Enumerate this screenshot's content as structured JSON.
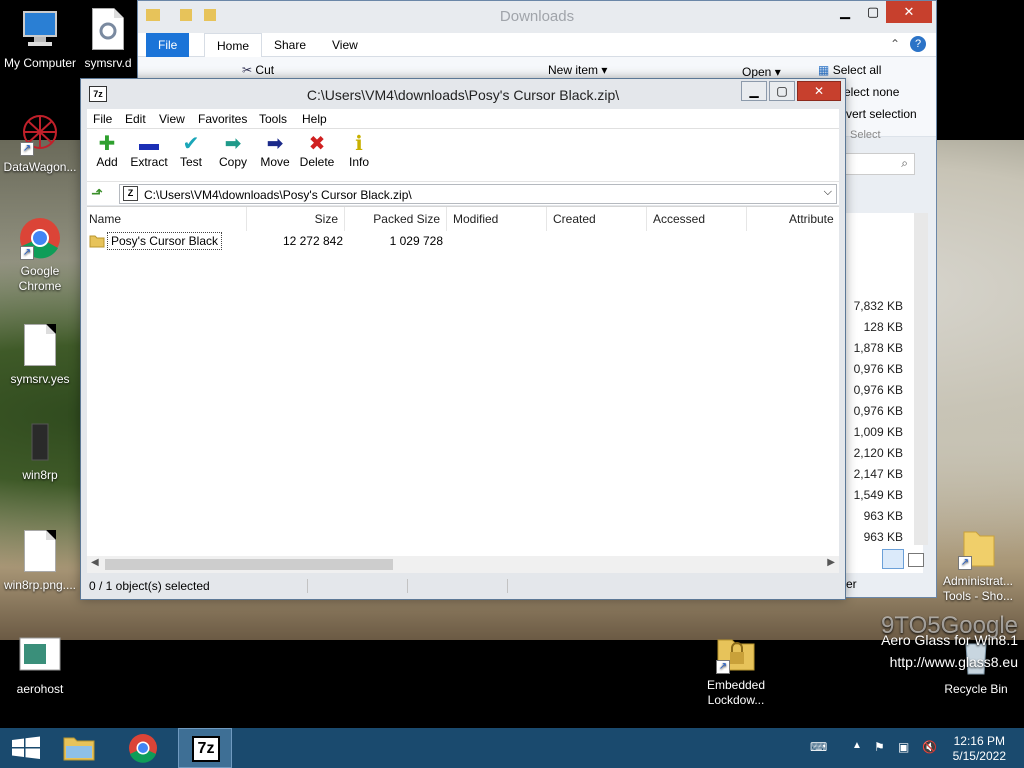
{
  "desktop": {
    "icons": [
      {
        "id": "my-computer",
        "label": "My Computer"
      },
      {
        "id": "symsrv-dll",
        "label": "symsrv.d"
      },
      {
        "id": "datawagon",
        "label": "DataWagon..."
      },
      {
        "id": "chrome",
        "label": "Google Chrome"
      },
      {
        "id": "symsrv-yes",
        "label": "symsrv.yes"
      },
      {
        "id": "win8rp",
        "label": "win8rp"
      },
      {
        "id": "win8rp-png",
        "label": "win8rp.png...."
      },
      {
        "id": "aerohost",
        "label": "aerohost"
      },
      {
        "id": "embedded",
        "label": "Embedded Lockdow..."
      },
      {
        "id": "admin-tools",
        "label": "Administrat... Tools - Sho..."
      },
      {
        "id": "recycle",
        "label": "Recycle Bin"
      }
    ],
    "watermark": "9TO5Google",
    "brand_line1": "Aero Glass for Win8.1",
    "brand_line2": "http://www.glass8.eu"
  },
  "explorer": {
    "title": "Downloads",
    "tabs": {
      "file": "File",
      "home": "Home",
      "share": "Share",
      "view": "View"
    },
    "ribbon": {
      "cut": "Cut",
      "new_item": "New item",
      "open": "Open",
      "select_all": "Select all",
      "select_none": "Select none",
      "invert": "Invert selection",
      "select_group": "Select"
    },
    "sizes": [
      "7,832 KB",
      "128 KB",
      "1,878 KB",
      "0,976 KB",
      "0,976 KB",
      "0,976 KB",
      "1,009 KB",
      "2,120 KB",
      "2,147 KB",
      "1,549 KB",
      "963 KB",
      "963 KB"
    ],
    "footer_partial": "er"
  },
  "sevenzip": {
    "title": "C:\\Users\\VM4\\downloads\\Posy's Cursor Black.zip\\",
    "menu": [
      "File",
      "Edit",
      "View",
      "Favorites",
      "Tools",
      "Help"
    ],
    "toolbar": [
      {
        "label": "Add",
        "glyph": "✚",
        "color": "#2ea02e"
      },
      {
        "label": "Extract",
        "glyph": "▬",
        "color": "#1b2fb5"
      },
      {
        "label": "Test",
        "glyph": "✔",
        "color": "#1aa6b8"
      },
      {
        "label": "Copy",
        "glyph": "➡",
        "color": "#1f9a8a"
      },
      {
        "label": "Move",
        "glyph": "➡",
        "color": "#1b2a8a"
      },
      {
        "label": "Delete",
        "glyph": "✖",
        "color": "#d02020"
      },
      {
        "label": "Info",
        "glyph": "ℹ",
        "color": "#c8b000"
      }
    ],
    "address": "C:\\Users\\VM4\\downloads\\Posy's Cursor Black.zip\\",
    "columns": [
      "Name",
      "Size",
      "Packed Size",
      "Modified",
      "Created",
      "Accessed",
      "Attribute"
    ],
    "rows": [
      {
        "name": "Posy's Cursor Black",
        "size": "12 272 842",
        "packed": "1 029 728"
      }
    ],
    "status": "0 / 1 object(s) selected"
  },
  "taskbar": {
    "time": "12:16 PM",
    "date": "5/15/2022"
  }
}
